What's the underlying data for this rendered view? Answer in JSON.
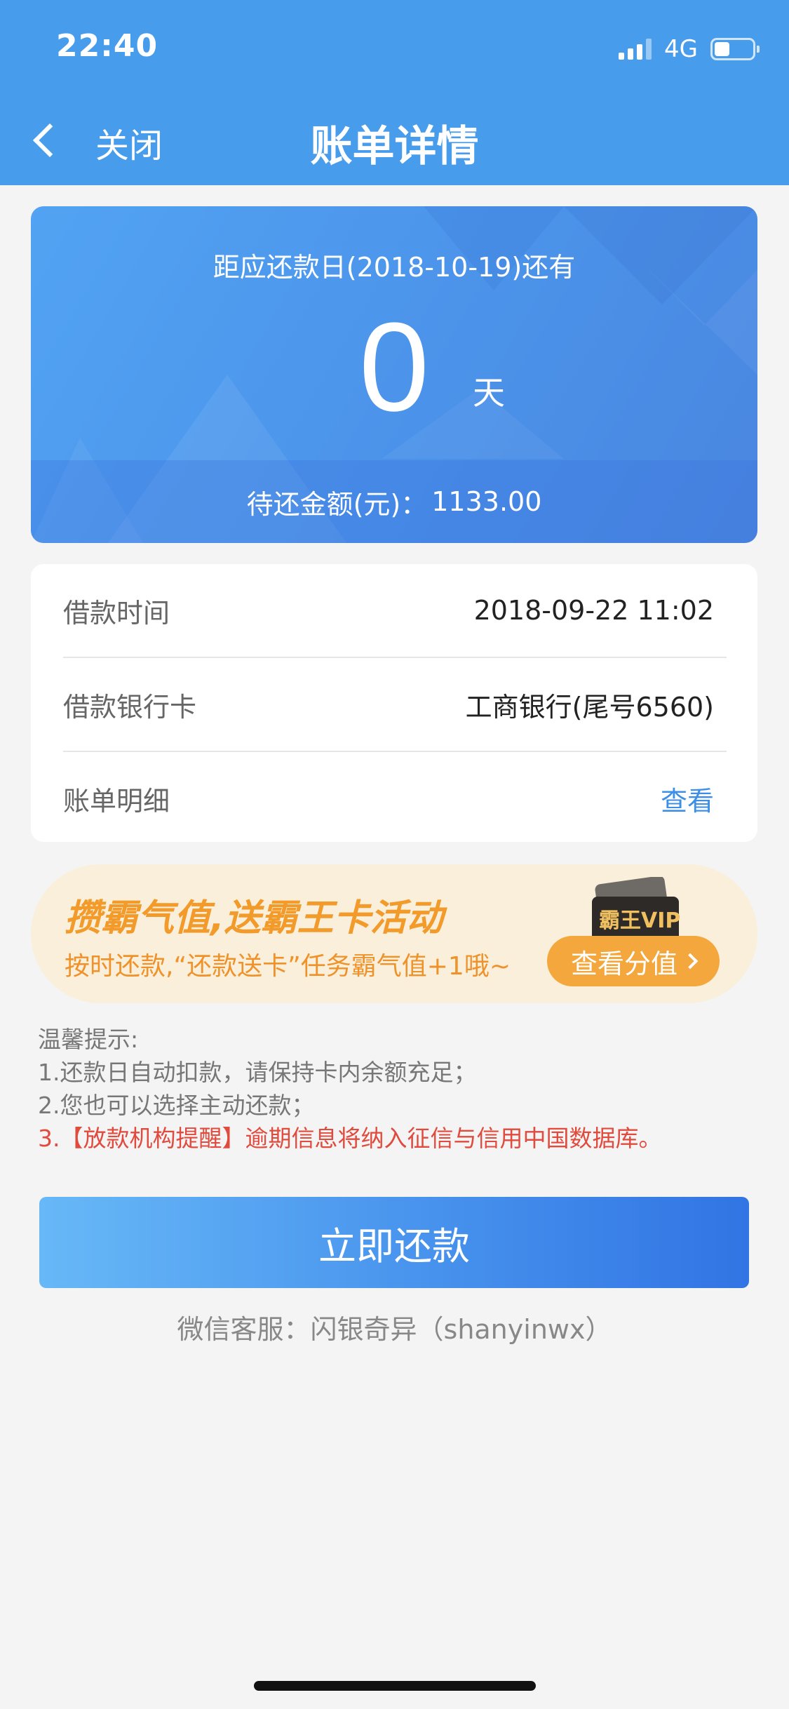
{
  "status_bar": {
    "time": "22:40",
    "network": "4G",
    "battery_level": 0.4
  },
  "header": {
    "back_icon": "chevron-left-icon",
    "close_label": "关闭",
    "title": "账单详情"
  },
  "summary": {
    "due_text": "距应还款日(2018-10-19)还有",
    "days_value": "0",
    "days_unit": "天",
    "amount_label": "待还金额(元)：",
    "amount_value": "1133.00"
  },
  "details": [
    {
      "label": "借款时间",
      "value": "2018-09-22 11:02"
    },
    {
      "label": "借款银行卡",
      "value": "工商银行(尾号6560)"
    },
    {
      "label": "账单明细",
      "value": "查看"
    }
  ],
  "promo": {
    "title": "攒霸气值,送霸王卡活动",
    "subtitle": "按时还款,“还款送卡”任务霸气值+1哦~",
    "card_badge": "霸王VIP",
    "button_label": "查看分值"
  },
  "tips": {
    "heading": "温馨提示:",
    "items": [
      "1.还款日自动扣款，请保持卡内余额充足；",
      "2.您也可以选择主动还款；",
      "3.【放款机构提醒】逾期信息将纳入征信与信用中国数据库。"
    ]
  },
  "actions": {
    "repay_label": "立即还款"
  },
  "footer": {
    "service_text": "微信客服：闪银奇异（shanyinwx）"
  },
  "colors": {
    "header_bg": "#489cec",
    "accent_blue": "#3d8fe5",
    "promo_orange": "#f4a73d",
    "warning_red": "#e04b3e"
  }
}
